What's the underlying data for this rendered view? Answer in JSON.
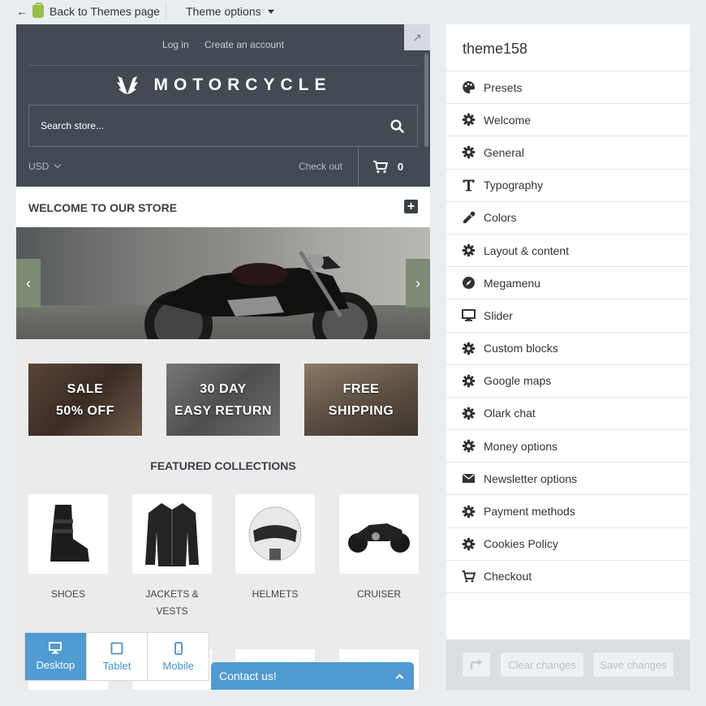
{
  "topbar": {
    "back_label": "Back to Themes page",
    "theme_options_label": "Theme options"
  },
  "store": {
    "header_links": [
      "Log in",
      "Create an account"
    ],
    "logo_text": "MOTORCYCLE",
    "search_placeholder": "Search store...",
    "currency": "USD",
    "checkout_label": "Check out",
    "cart_count": "0",
    "welcome_title": "WELCOME TO OUR STORE",
    "banners": [
      {
        "line1": "SALE",
        "line2": "50% OFF"
      },
      {
        "line1": "30 DAY",
        "line2": "EASY RETURN"
      },
      {
        "line1": "FREE",
        "line2": "SHIPPING"
      }
    ],
    "featured_title": "FEATURED COLLECTIONS",
    "collections": [
      {
        "line1": "SHOES",
        "line2": ""
      },
      {
        "line1": "JACKETS &",
        "line2": "VESTS"
      },
      {
        "line1": "HELMETS",
        "line2": ""
      },
      {
        "line1": "CRUISER",
        "line2": ""
      }
    ]
  },
  "devices": {
    "active": "Desktop",
    "items": [
      "Desktop",
      "Tablet",
      "Mobile"
    ]
  },
  "contact_label": "Contact us!",
  "panel": {
    "title": "theme158",
    "items": [
      {
        "label": "Presets",
        "icon": "palette-icon"
      },
      {
        "label": "Welcome",
        "icon": "gear-icon"
      },
      {
        "label": "General",
        "icon": "gear-icon"
      },
      {
        "label": "Typography",
        "icon": "text-icon"
      },
      {
        "label": "Colors",
        "icon": "eyedropper-icon"
      },
      {
        "label": "Layout & content",
        "icon": "gear-icon"
      },
      {
        "label": "Megamenu",
        "icon": "compass-icon"
      },
      {
        "label": "Slider",
        "icon": "monitor-icon"
      },
      {
        "label": "Custom blocks",
        "icon": "gear-icon"
      },
      {
        "label": "Google maps",
        "icon": "gear-icon"
      },
      {
        "label": "Olark chat",
        "icon": "gear-icon"
      },
      {
        "label": "Money options",
        "icon": "gear-icon"
      },
      {
        "label": "Newsletter options",
        "icon": "envelope-icon"
      },
      {
        "label": "Payment methods",
        "icon": "gear-icon"
      },
      {
        "label": "Cookies Policy",
        "icon": "gear-icon"
      },
      {
        "label": "Checkout",
        "icon": "cart-icon"
      }
    ],
    "clear_label": "Clear changes",
    "save_label": "Save changes"
  },
  "colors": {
    "accent": "#4f9bd2",
    "header_bg": "#434a54",
    "page_bg": "#eaedf0"
  }
}
